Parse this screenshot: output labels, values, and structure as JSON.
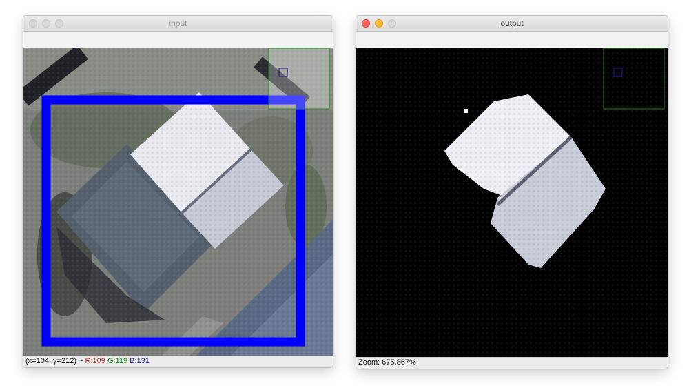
{
  "windows": {
    "input": {
      "title": "input",
      "status": {
        "coords": "(x=104, y=212) ~ ",
        "r": "R:109",
        "g": "G:119",
        "b": "B:131"
      }
    },
    "output": {
      "title": "output",
      "status": {
        "zoom": "Zoom: 675.867%"
      }
    }
  },
  "colors": {
    "selection_rect": "#0000ff",
    "navigator_outline": "#1f8a1f",
    "status_r": "#e01515",
    "status_g": "#0a8a0a",
    "status_b": "#1515d8"
  },
  "icons": [
    "close-light",
    "minimize-light",
    "zoom-light"
  ]
}
